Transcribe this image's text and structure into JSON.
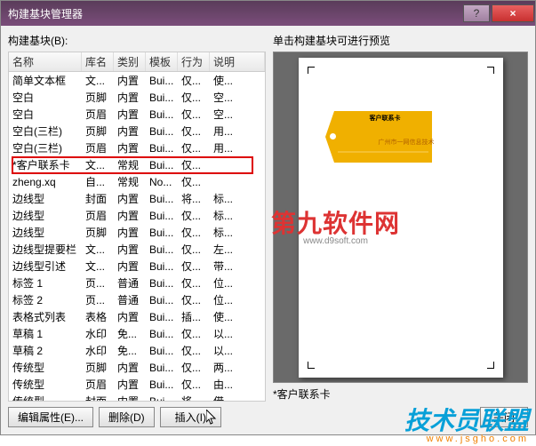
{
  "window": {
    "title": "构建基块管理器",
    "help_icon": "?",
    "close_icon": "×"
  },
  "left": {
    "label": "构建基块(B):",
    "headers": [
      "名称",
      "库名",
      "类别",
      "模板",
      "行为",
      "说明"
    ],
    "rows": [
      {
        "c": [
          "简单文本框",
          "文...",
          "内置",
          "Bui...",
          "仅...",
          "使..."
        ]
      },
      {
        "c": [
          "空白",
          "页脚",
          "内置",
          "Bui...",
          "仅...",
          "空..."
        ]
      },
      {
        "c": [
          "空白",
          "页眉",
          "内置",
          "Bui...",
          "仅...",
          "空..."
        ]
      },
      {
        "c": [
          "空白(三栏)",
          "页脚",
          "内置",
          "Bui...",
          "仅...",
          "用..."
        ]
      },
      {
        "c": [
          "空白(三栏)",
          "页眉",
          "内置",
          "Bui...",
          "仅...",
          "用..."
        ]
      },
      {
        "c": [
          "*客户联系卡",
          "文...",
          "常规",
          "Bui...",
          "仅...",
          ""
        ]
      },
      {
        "c": [
          "zheng.xq",
          "自...",
          "常规",
          "No...",
          "仅...",
          ""
        ]
      },
      {
        "c": [
          "边线型",
          "封面",
          "内置",
          "Bui...",
          "将...",
          "标..."
        ]
      },
      {
        "c": [
          "边线型",
          "页眉",
          "内置",
          "Bui...",
          "仅...",
          "标..."
        ]
      },
      {
        "c": [
          "边线型",
          "页脚",
          "内置",
          "Bui...",
          "仅...",
          "标..."
        ]
      },
      {
        "c": [
          "边线型提要栏",
          "文...",
          "内置",
          "Bui...",
          "仅...",
          "左..."
        ]
      },
      {
        "c": [
          "边线型引述",
          "文...",
          "内置",
          "Bui...",
          "仅...",
          "带..."
        ]
      },
      {
        "c": [
          "标签 1",
          "页...",
          "普通",
          "Bui...",
          "仅...",
          "位..."
        ]
      },
      {
        "c": [
          "标签 2",
          "页...",
          "普通",
          "Bui...",
          "仅...",
          "位..."
        ]
      },
      {
        "c": [
          "表格式列表",
          "表格",
          "内置",
          "Bui...",
          "插...",
          "使..."
        ]
      },
      {
        "c": [
          "草稿 1",
          "水印",
          "免...",
          "Bui...",
          "仅...",
          "以..."
        ]
      },
      {
        "c": [
          "草稿 2",
          "水印",
          "免...",
          "Bui...",
          "仅...",
          "以..."
        ]
      },
      {
        "c": [
          "传统型",
          "页脚",
          "内置",
          "Bui...",
          "仅...",
          "两..."
        ]
      },
      {
        "c": [
          "传统型",
          "页眉",
          "内置",
          "Bui...",
          "仅...",
          "由..."
        ]
      },
      {
        "c": [
          "传统型",
          "封面",
          "内置",
          "Bui...",
          "将...",
          "借..."
        ]
      }
    ],
    "highlighted_row_index": 5
  },
  "buttons": {
    "edit_props": "编辑属性(E)...",
    "delete": "删除(D)",
    "insert": "插入(I)"
  },
  "right": {
    "label": "单击构建基块可进行预览",
    "caption": "*客户联系卡",
    "tag_text1": "客户联系卡",
    "tag_text2": "广州市一网信息技术",
    "close": "关闭"
  },
  "watermarks": {
    "red_text": "第九软件网",
    "red_sub": "www.d9soft.com",
    "blue_text": "技术员联盟",
    "blue_sub": "www.jsgho.com"
  }
}
